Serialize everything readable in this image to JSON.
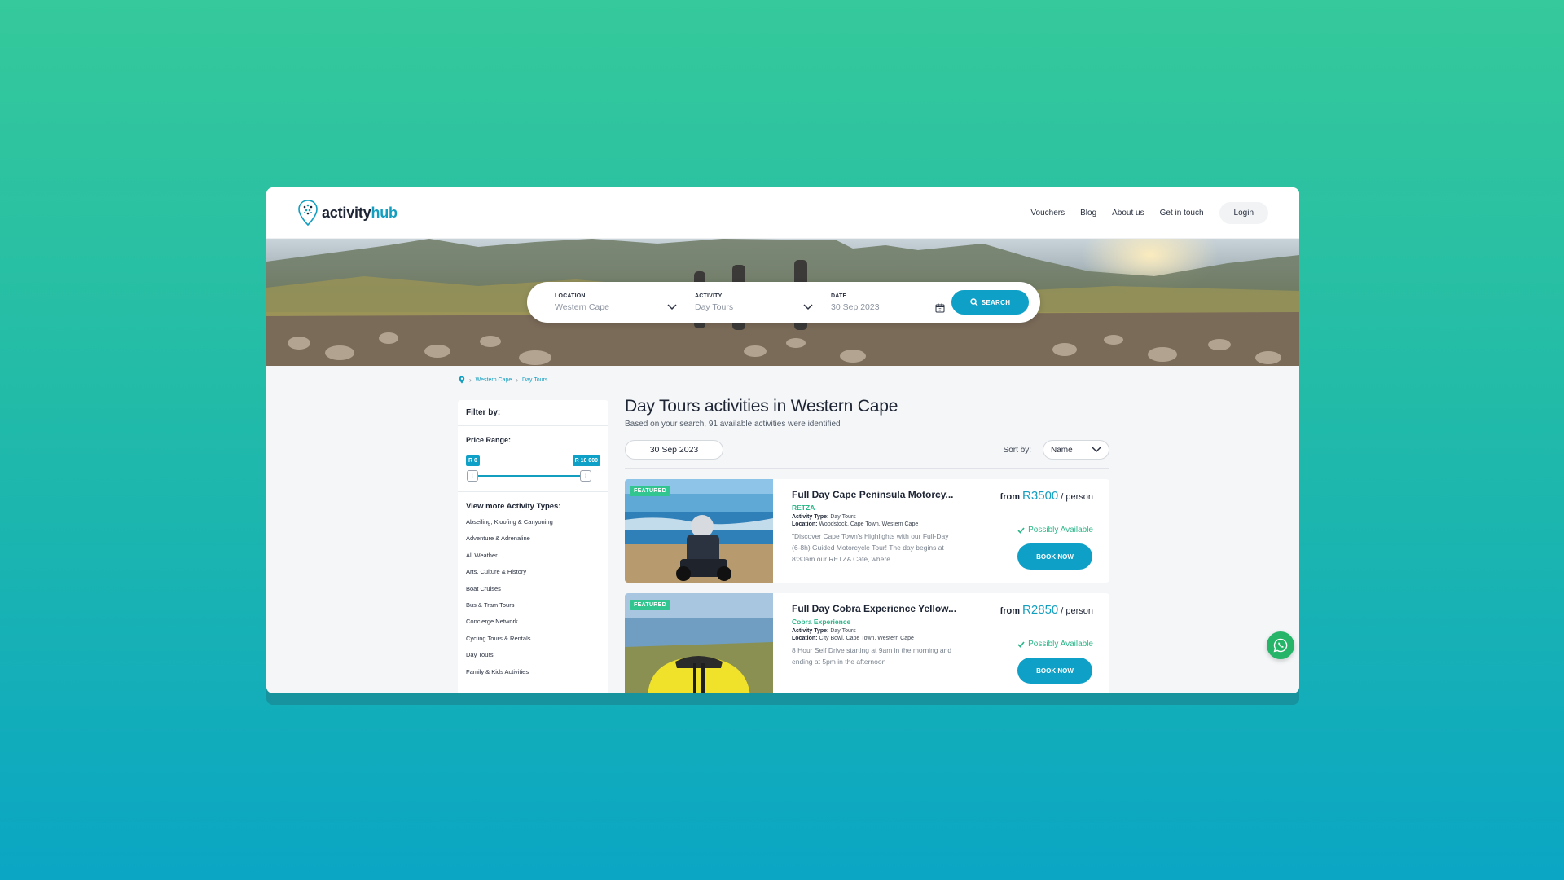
{
  "brand": {
    "name_prefix": "activity",
    "name_suffix": "hub"
  },
  "nav": {
    "items": [
      {
        "label": "Vouchers"
      },
      {
        "label": "Blog"
      },
      {
        "label": "About us"
      },
      {
        "label": "Get in touch"
      }
    ],
    "login_label": "Login"
  },
  "search": {
    "location_label": "LOCATION",
    "location_value": "Western Cape",
    "activity_label": "ACTIVITY",
    "activity_value": "Day Tours",
    "date_label": "DATE",
    "date_value": "30 Sep 2023",
    "button_label": "SEARCH"
  },
  "breadcrumb": [
    "Western Cape",
    "Day Tours"
  ],
  "filters": {
    "title": "Filter by:",
    "price_range_label": "Price Range:",
    "price_min": "R 0",
    "price_max": "R 10 000",
    "types_title": "View more Activity Types:",
    "types": [
      "Abseiling, Kloofing & Canyoning",
      "Adventure & Adrenaline",
      "All Weather",
      "Arts, Culture & History",
      "Boat Cruises",
      "Bus & Tram Tours",
      "Concierge Network",
      "Cycling Tours & Rentals",
      "Day Tours",
      "Family & Kids Activities"
    ]
  },
  "results": {
    "title": "Day Tours activities in Western Cape",
    "subtitle": "Based on your search, 91 available activities were identified",
    "date_pill": "30 Sep 2023",
    "sort_label": "Sort by:",
    "sort_value": "Name",
    "cards": [
      {
        "badge": "FEATURED",
        "title": "Full Day Cape Peninsula Motorcy...",
        "operator": "RETZA",
        "activity_type_label": "Activity Type:",
        "activity_type": "Day Tours",
        "location_label": "Location:",
        "location": "Woodstock, Cape Town, Western Cape",
        "description": "\"Discover Cape Town's Highlights with our Full-Day (6-8h) Guided Motorcycle Tour! The day begins at 8:30am our RETZA Cafe, where",
        "price_from": "from",
        "price": "R3500",
        "price_unit": "/ person",
        "availability": "Possibly Available",
        "book_label": "BOOK NOW"
      },
      {
        "badge": "FEATURED",
        "title": "Full Day Cobra Experience Yellow...",
        "operator": "Cobra Experience",
        "activity_type_label": "Activity Type:",
        "activity_type": "Day Tours",
        "location_label": "Location:",
        "location": "City Bowl, Cape Town, Western Cape",
        "description": "8 Hour Self Drive starting at 9am in the morning and ending at 5pm in the afternoon",
        "price_from": "from",
        "price": "R2850",
        "price_unit": "/ person",
        "availability": "Possibly Available",
        "book_label": "BOOK NOW"
      }
    ]
  },
  "colors": {
    "accent": "#0fa0c7",
    "success": "#2bb78a",
    "featured": "#33c58f",
    "whatsapp": "#25b468"
  }
}
